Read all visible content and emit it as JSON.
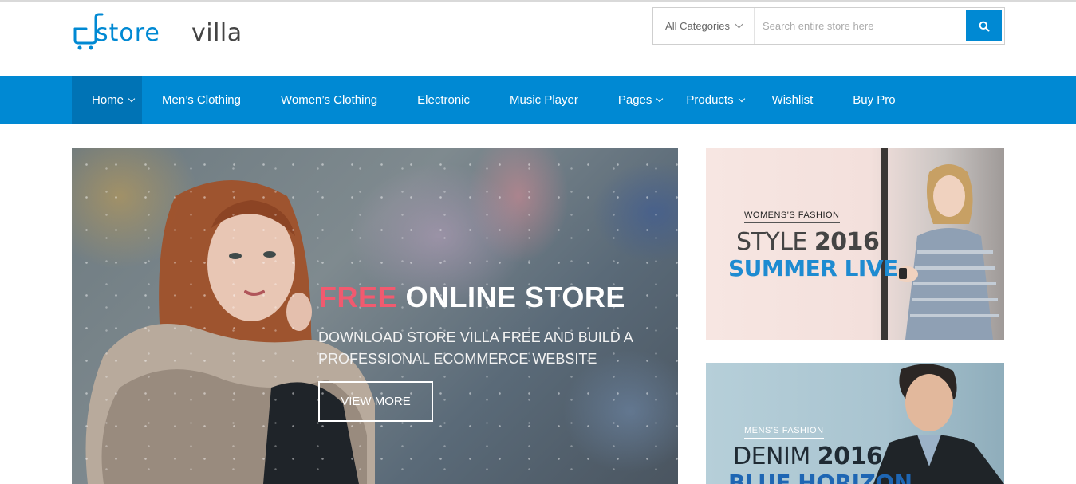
{
  "brand": {
    "name_part1": "store",
    "name_part2": "villa",
    "accent_color": "#0089d3"
  },
  "search": {
    "category_selected": "All Categories",
    "placeholder": "Search entire store here",
    "value": "",
    "button_icon": "search-icon"
  },
  "nav": {
    "items": [
      {
        "label": "Home",
        "has_dropdown": true,
        "active": true
      },
      {
        "label": "Men’s Clothing",
        "has_dropdown": false
      },
      {
        "label": "Women’s Clothing",
        "has_dropdown": false
      },
      {
        "label": "Electronic",
        "has_dropdown": false
      },
      {
        "label": "Music Player",
        "has_dropdown": false
      },
      {
        "label": "Pages",
        "has_dropdown": true
      },
      {
        "label": "Products",
        "has_dropdown": true
      },
      {
        "label": "Wishlist",
        "has_dropdown": false
      },
      {
        "label": "Buy Pro",
        "has_dropdown": false
      }
    ]
  },
  "hero": {
    "title_highlight": "FREE",
    "title_rest": "ONLINE STORE",
    "highlight_color": "#f15a6f",
    "subtitle": "DOWNLOAD STORE VILLA FREE AND BUILD A PROFESSIONAL ECOMMERCE WEBSITE",
    "button_label": "VIEW MORE"
  },
  "banners": {
    "womens": {
      "label": "WOMENS'S FASHION",
      "line1_light": "STYLE",
      "line1_bold": "2016",
      "line2": "SUMMER LIVE",
      "line2_color": "#1e8bd1"
    },
    "mens": {
      "label": "MENS'S FASHION",
      "line1_light": "DENIM",
      "line1_bold": "2016",
      "line2": "BLUE HORIZON",
      "line2_color": "#1e66b4"
    }
  }
}
